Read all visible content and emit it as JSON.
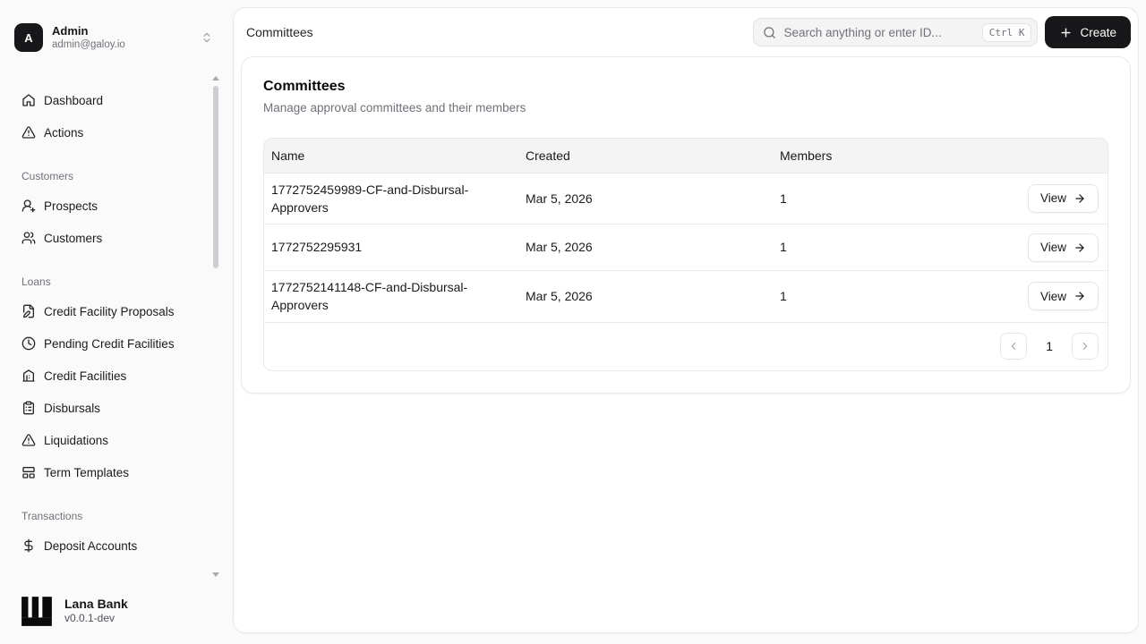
{
  "user": {
    "initial": "A",
    "name": "Admin",
    "email": "admin@galoy.io"
  },
  "sidebar": {
    "sections": [
      {
        "label": "",
        "items": [
          {
            "icon": "home-icon",
            "label": "Dashboard"
          },
          {
            "icon": "alert-triangle-icon",
            "label": "Actions"
          }
        ]
      },
      {
        "label": "Customers",
        "items": [
          {
            "icon": "user-plus-icon",
            "label": "Prospects"
          },
          {
            "icon": "users-icon",
            "label": "Customers"
          }
        ]
      },
      {
        "label": "Loans",
        "items": [
          {
            "icon": "file-pen-icon",
            "label": "Credit Facility Proposals"
          },
          {
            "icon": "clock-icon",
            "label": "Pending Credit Facilities"
          },
          {
            "icon": "bank-icon",
            "label": "Credit Facilities"
          },
          {
            "icon": "clipboard-list-icon",
            "label": "Disbursals"
          },
          {
            "icon": "alert-triangle-icon",
            "label": "Liquidations"
          },
          {
            "icon": "layout-panel-icon",
            "label": "Term Templates"
          }
        ]
      },
      {
        "label": "Transactions",
        "items": [
          {
            "icon": "dollar-icon",
            "label": "Deposit Accounts"
          }
        ]
      }
    ],
    "footer": {
      "brand": "Lana Bank",
      "version": "v0.0.1-dev"
    }
  },
  "header": {
    "breadcrumb": "Committees",
    "search_placeholder": "Search anything or enter ID...",
    "shortcut": "Ctrl K",
    "create_label": "Create"
  },
  "page": {
    "title": "Committees",
    "subtitle": "Manage approval committees and their members"
  },
  "table": {
    "columns": [
      "Name",
      "Created",
      "Members"
    ],
    "rows": [
      {
        "name": "1772752459989-CF-and-Disbursal-Approvers",
        "created": "Mar 5, 2026",
        "members": "1",
        "action": "View"
      },
      {
        "name": "1772752295931",
        "created": "Mar 5, 2026",
        "members": "1",
        "action": "View"
      },
      {
        "name": "1772752141148-CF-and-Disbursal-Approvers",
        "created": "Mar 5, 2026",
        "members": "1",
        "action": "View"
      }
    ],
    "pagination": {
      "current_page": "1"
    }
  },
  "colors": {
    "accent": "#18181b",
    "page_background": "#fafafa",
    "panel_background": "#ffffff",
    "border": "#e4e4e7",
    "muted_text": "#71717a",
    "table_header_background": "#f4f4f5"
  }
}
